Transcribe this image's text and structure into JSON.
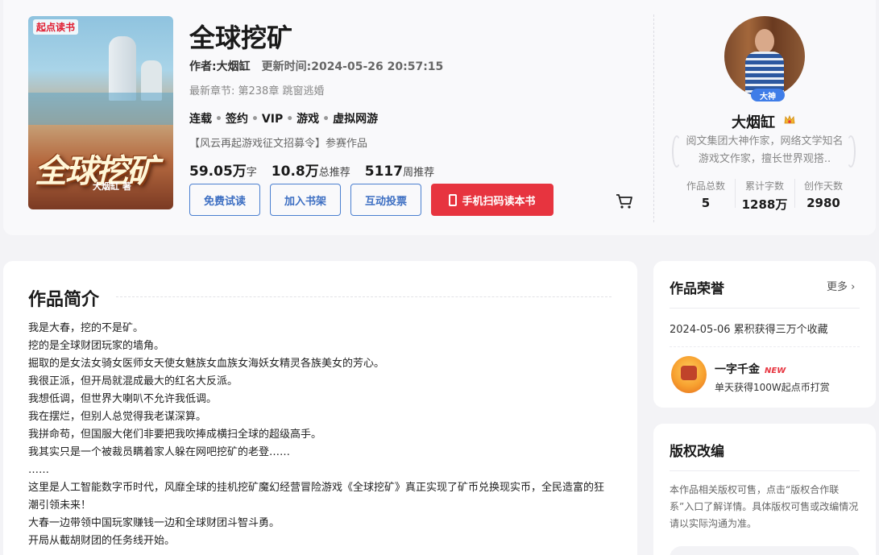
{
  "book": {
    "title": "全球挖矿",
    "author_label": "作者:大烟缸",
    "update_label": "更新时间:2024-05-26 20:57:15",
    "latest_chapter": "最新章节: 第238章 跳窗逃婚",
    "tags": [
      "连载",
      "签约",
      "VIP",
      "游戏",
      "虚拟网游"
    ],
    "event": "【风云再起游戏征文招募令】参赛作品",
    "stats": [
      {
        "num": "59.05万",
        "unit": "字"
      },
      {
        "num": "10.8万",
        "unit": "总推荐"
      },
      {
        "num": "5117",
        "unit": "周推荐"
      }
    ],
    "cover": {
      "logo": "起点读书",
      "title_art": "全球挖矿",
      "author_art": "大烟缸 著"
    }
  },
  "actions": {
    "free_trial": "免费试读",
    "add_shelf": "加入书架",
    "vote": "互动投票",
    "mobile_read": "手机扫码读本书"
  },
  "author": {
    "badge": "大神",
    "name": "大烟缸",
    "desc": "阅文集团大神作家，网络文学知名游戏文作家，擅长世界观搭..",
    "stats": [
      {
        "label": "作品总数",
        "value": "5"
      },
      {
        "label": "累计字数",
        "value": "1288万"
      },
      {
        "label": "创作天数",
        "value": "2980"
      }
    ]
  },
  "intro": {
    "title": "作品简介",
    "lines": [
      "我是大春，挖的不是矿。",
      "挖的是全球财团玩家的墙角。",
      "掘取的是女法女骑女医师女天使女魅族女血族女海妖女精灵各族美女的芳心。",
      "我很正派，但开局就混成最大的红名大反派。",
      "我想低调，但世界大喇叭不允许我低调。",
      "我在摆烂，但别人总觉得我老谋深算。",
      "我拼命苟，但国服大佬们非要把我吹捧成横扫全球的超级高手。",
      "我其实只是一个被裁员瞒着家人躲在网吧挖矿的老登……",
      "……",
      "这里是人工智能数字币时代，风靡全球的挂机挖矿魔幻经营冒险游戏《全球挖矿》真正实现了矿币兑换现实币，全民造富的狂潮引领未来！",
      "大春一边带领中国玩家赚钱一边和全球财团斗智斗勇。",
      "开局从截胡财团的任务线开始。"
    ]
  },
  "honors": {
    "title": "作品荣誉",
    "more": "更多",
    "item": "2024-05-06 累积获得三万个收藏",
    "medal_name": "一字千金",
    "new_tag": "NEW",
    "medal_desc": "单天获得100W起点币打赏"
  },
  "copyright": {
    "title": "版权改编",
    "text": "本作品相关版权可售，点击“版权合作联系”入口了解详情。具体版权可售或改编情况请以实际沟通为准。"
  }
}
